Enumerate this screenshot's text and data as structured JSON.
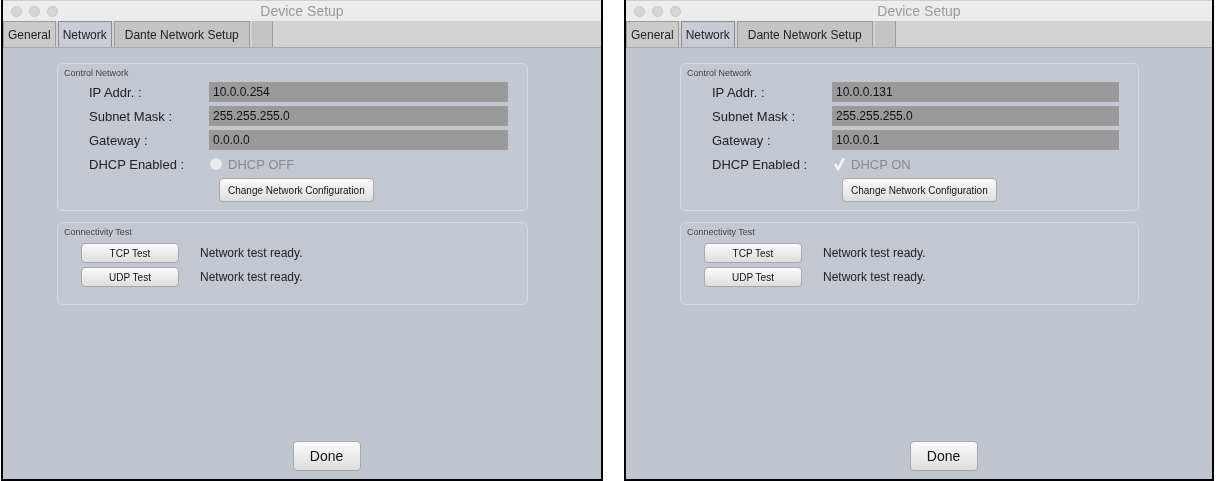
{
  "windows": [
    {
      "title": "Device Setup",
      "tabs": [
        {
          "label": "General",
          "selected": false
        },
        {
          "label": "Network",
          "selected": true
        },
        {
          "label": "Dante Network Setup",
          "selected": false
        }
      ],
      "control_network": {
        "caption": "Control Network",
        "fields": [
          {
            "label": "IP Addr. :",
            "value": "10.0.0.254"
          },
          {
            "label": "Subnet Mask :",
            "value": "255.255.255.0"
          },
          {
            "label": "Gateway :",
            "value": "0.0.0.0"
          }
        ],
        "dhcp": {
          "label": "DHCP Enabled :",
          "text": "DHCP OFF",
          "checked": false
        },
        "change_button": "Change Network Configuration"
      },
      "connectivity_test": {
        "caption": "Connectivity Test",
        "tests": [
          {
            "button": "TCP Test",
            "status": "Network test ready."
          },
          {
            "button": "UDP Test",
            "status": "Network test ready."
          }
        ]
      },
      "done_button": "Done"
    },
    {
      "title": "Device Setup",
      "tabs": [
        {
          "label": "General",
          "selected": false
        },
        {
          "label": "Network",
          "selected": true
        },
        {
          "label": "Dante Network Setup",
          "selected": false
        }
      ],
      "control_network": {
        "caption": "Control Network",
        "fields": [
          {
            "label": "IP Addr. :",
            "value": "10.0.0.131"
          },
          {
            "label": "Subnet Mask :",
            "value": "255.255.255.0"
          },
          {
            "label": "Gateway :",
            "value": "10.0.0.1"
          }
        ],
        "dhcp": {
          "label": "DHCP Enabled :",
          "text": "DHCP ON",
          "checked": true
        },
        "change_button": "Change Network Configuration"
      },
      "connectivity_test": {
        "caption": "Connectivity Test",
        "tests": [
          {
            "button": "TCP Test",
            "status": "Network test ready."
          },
          {
            "button": "UDP Test",
            "status": "Network test ready."
          }
        ]
      },
      "done_button": "Done"
    }
  ]
}
